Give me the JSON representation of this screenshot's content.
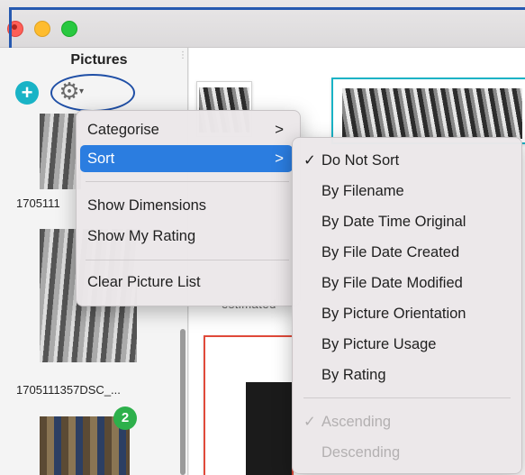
{
  "sidebar": {
    "title": "Pictures",
    "add_glyph": "+",
    "gear_glyph": "⚙",
    "caret_glyph": "▾",
    "thumbnails": [
      {
        "label": "1705111"
      },
      {
        "label": "1705111357DSC_..."
      },
      {
        "badge": "2"
      }
    ]
  },
  "main": {
    "estimated_text": "estimated"
  },
  "picture_menu": {
    "items": [
      {
        "label": "Categorise",
        "submenu": true
      },
      {
        "label": "Sort",
        "submenu": true,
        "selected": true
      },
      {
        "label": "Show Dimensions"
      },
      {
        "label": "Show My Rating"
      },
      {
        "label": "Clear Picture List"
      }
    ],
    "chevron": ">"
  },
  "sort_menu": {
    "check_glyph": "✓",
    "items": [
      {
        "label": "Do Not Sort",
        "checked": true
      },
      {
        "label": "By Filename"
      },
      {
        "label": "By Date Time Original"
      },
      {
        "label": "By File Date Created"
      },
      {
        "label": "By File Date Modified"
      },
      {
        "label": "By Picture Orientation"
      },
      {
        "label": "By Picture Usage"
      },
      {
        "label": "By Rating"
      }
    ],
    "order_items": [
      {
        "label": "Ascending",
        "checked": true,
        "disabled": true
      },
      {
        "label": "Descending",
        "disabled": true
      }
    ]
  },
  "colors": {
    "accent": "#2b7de0",
    "add_button": "#19b3c6",
    "badge": "#2db04b",
    "annotation": "#1f4fa6"
  }
}
